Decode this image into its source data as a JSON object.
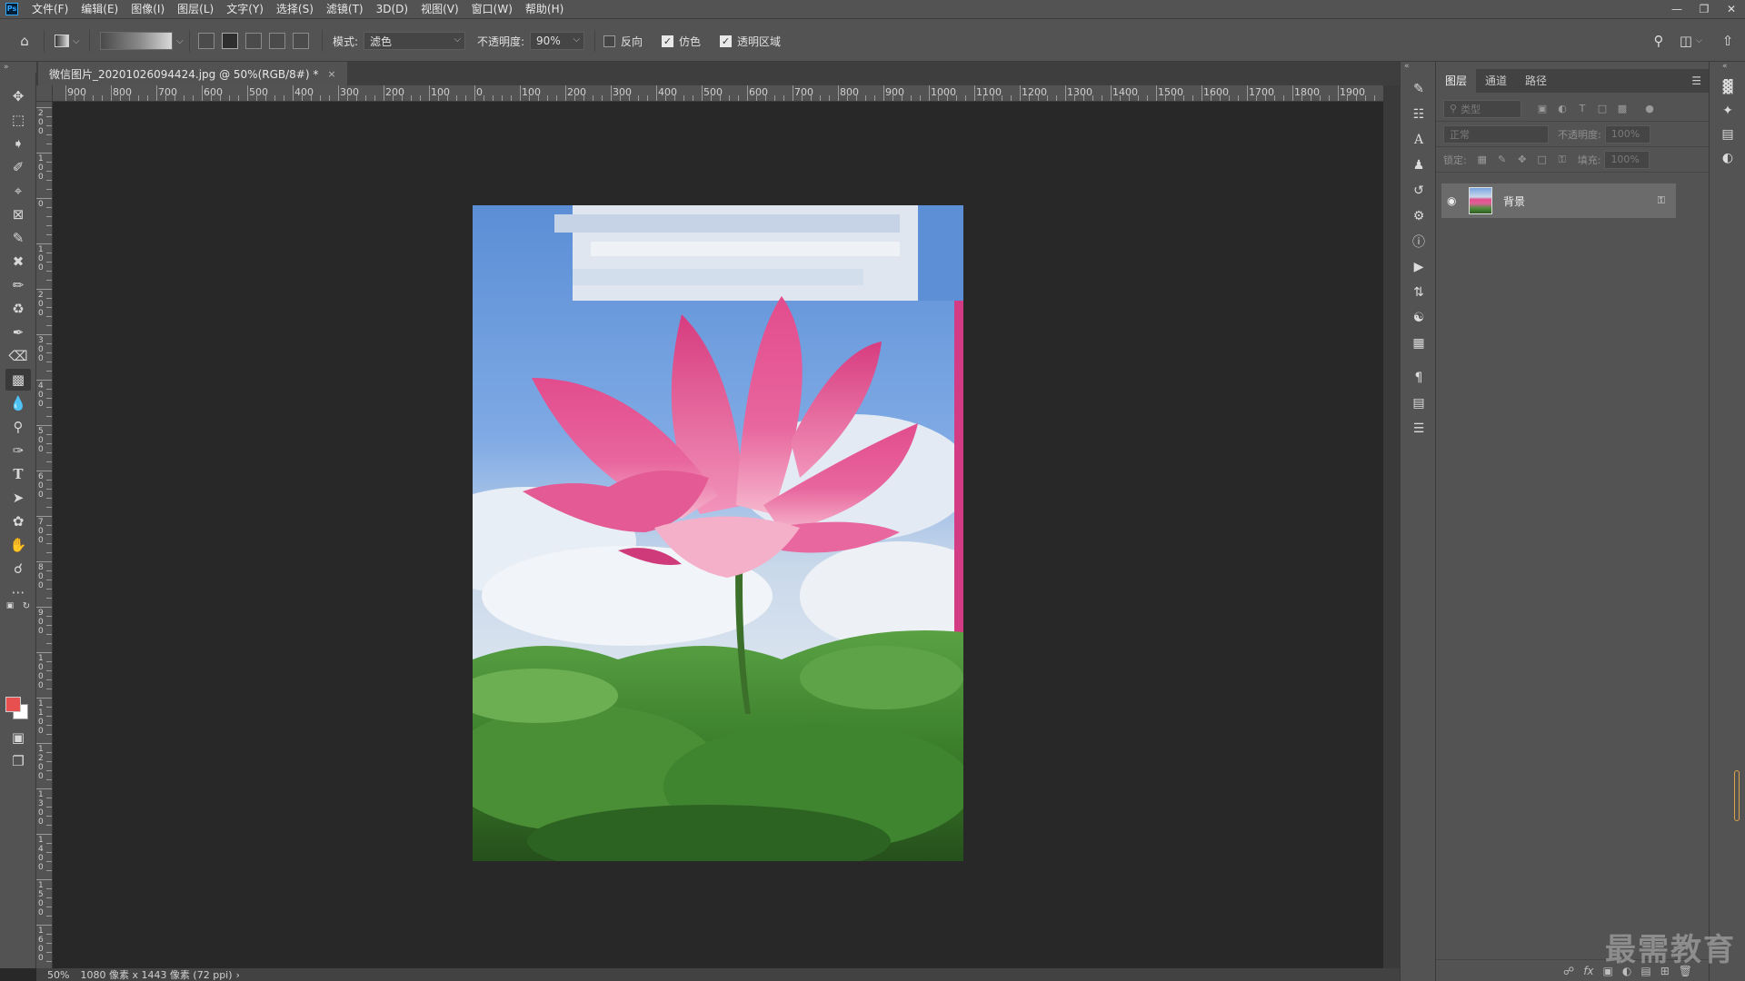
{
  "menubar": {
    "logo": "Ps",
    "items": [
      "文件(F)",
      "编辑(E)",
      "图像(I)",
      "图层(L)",
      "文字(Y)",
      "选择(S)",
      "滤镜(T)",
      "3D(D)",
      "视图(V)",
      "窗口(W)",
      "帮助(H)"
    ],
    "window_controls": [
      "minimize-icon",
      "restore-icon",
      "close-icon"
    ]
  },
  "options": {
    "mode_label": "模式:",
    "mode_value": "滤色",
    "opacity_label": "不透明度:",
    "opacity_value": "90%",
    "reverse_label": "反向",
    "reverse_checked": false,
    "dither_label": "仿色",
    "dither_checked": true,
    "transparency_label": "透明区域",
    "transparency_checked": true
  },
  "document": {
    "tab_title": "微信图片_20201026094424.jpg @ 50%(RGB/8#) *",
    "close": "×",
    "hruler_labels": [
      "900",
      "800",
      "700",
      "600",
      "500",
      "400",
      "300",
      "200",
      "100",
      "0",
      "100",
      "200",
      "300",
      "400",
      "500",
      "600",
      "700",
      "800",
      "900",
      "1000",
      "1100",
      "1200",
      "1300",
      "1400",
      "1500",
      "1600",
      "1700",
      "1800",
      "1900"
    ],
    "vruler_labels": [
      "200",
      "100",
      "0",
      "100",
      "200",
      "300",
      "400",
      "500",
      "600",
      "700",
      "800",
      "900",
      "1000",
      "1100",
      "1200",
      "1300",
      "1400",
      "1500",
      "1600"
    ]
  },
  "status": {
    "zoom": "50%",
    "info": "1080 像素 x 1443 像素 (72 ppi)",
    "arrow": "›"
  },
  "layers_panel": {
    "tabs": [
      "图层",
      "通道",
      "路径"
    ],
    "filter_placeholder": "类型",
    "blend_mode": "正常",
    "opacity_label": "不透明度:",
    "opacity_value": "100%",
    "lock_label": "锁定:",
    "fill_label": "填充:",
    "fill_value": "100%",
    "layer_name": "背景"
  },
  "colors": {
    "foreground": "#e8504f",
    "background": "#ffffff",
    "ui_panel": "#535353",
    "canvas_bg": "#282828"
  },
  "watermark": "最需教育"
}
